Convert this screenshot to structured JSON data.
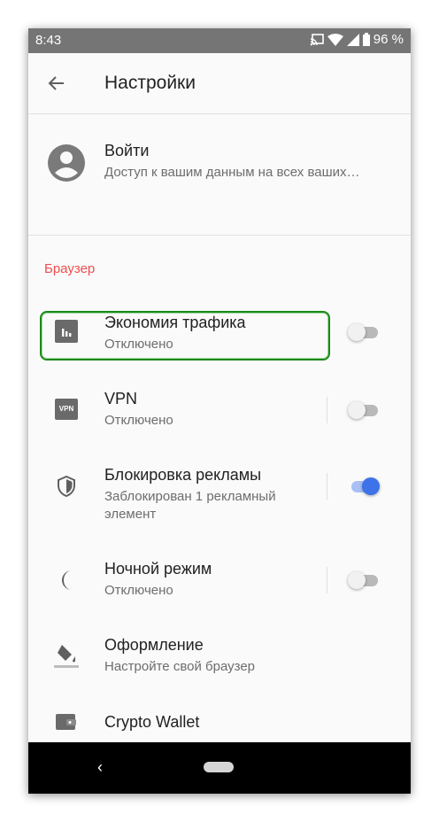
{
  "statusbar": {
    "time": "8:43",
    "battery": "96 %"
  },
  "appbar": {
    "title": "Настройки"
  },
  "account": {
    "title": "Войти",
    "subtitle": "Доступ к вашим данным на всех ваших…"
  },
  "section": {
    "browser": "Браузер"
  },
  "items": [
    {
      "title": "Экономия трафика",
      "subtitle": "Отключено",
      "enabled": false
    },
    {
      "title": "VPN",
      "subtitle": "Отключено",
      "enabled": false,
      "icon_text": "VPN"
    },
    {
      "title": "Блокировка рекламы",
      "subtitle_line1": "Заблокирован 1 рекламный",
      "subtitle_line2": "элемент",
      "enabled": true
    },
    {
      "title": "Ночной режим",
      "subtitle": "Отключено",
      "enabled": false
    },
    {
      "title": "Оформление",
      "subtitle": "Настройте свой браузер"
    },
    {
      "title": "Crypto Wallet"
    }
  ],
  "nav": {
    "back": "‹"
  },
  "colors": {
    "accent": "#3d72e8",
    "section": "#f04d4d",
    "status_bar": "#757575",
    "highlight": "#1a8a1a"
  }
}
